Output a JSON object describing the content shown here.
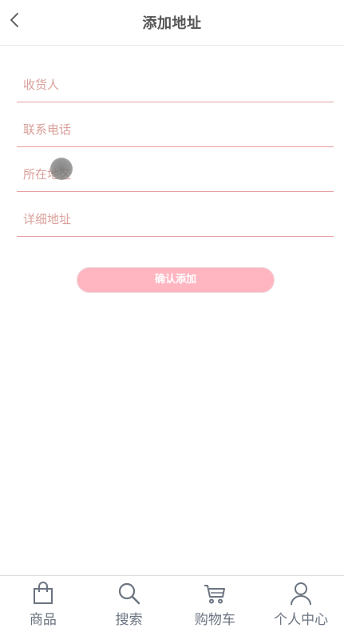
{
  "header": {
    "title": "添加地址",
    "back_icon": "chevron-left-icon"
  },
  "form": {
    "fields": [
      {
        "name": "recipient",
        "placeholder": "收货人",
        "value": ""
      },
      {
        "name": "phone",
        "placeholder": "联系电话",
        "value": ""
      },
      {
        "name": "region",
        "placeholder": "所在地区",
        "value": ""
      },
      {
        "name": "address",
        "placeholder": "详细地址",
        "value": ""
      }
    ],
    "submit_label": "确认添加"
  },
  "tabbar": {
    "items": [
      {
        "label": "商品",
        "icon": "shopping-bag-icon"
      },
      {
        "label": "搜索",
        "icon": "search-icon"
      },
      {
        "label": "购物车",
        "icon": "cart-icon"
      },
      {
        "label": "个人中心",
        "icon": "user-icon"
      }
    ]
  },
  "colors": {
    "accent": "#ffb6c1",
    "field_line": "#e6a0a0",
    "placeholder": "#d9a09a",
    "tab_label": "#6b7480"
  }
}
